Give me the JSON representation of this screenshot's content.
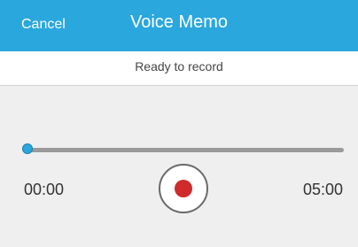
{
  "header": {
    "cancel_label": "Cancel",
    "title": "Voice Memo"
  },
  "status": {
    "text": "Ready to record"
  },
  "player": {
    "elapsed": "00:00",
    "total": "05:00",
    "progress_fraction": 0
  },
  "icons": {
    "record": "record-icon"
  },
  "colors": {
    "accent": "#2aa7dd",
    "record": "#d02b2b"
  }
}
